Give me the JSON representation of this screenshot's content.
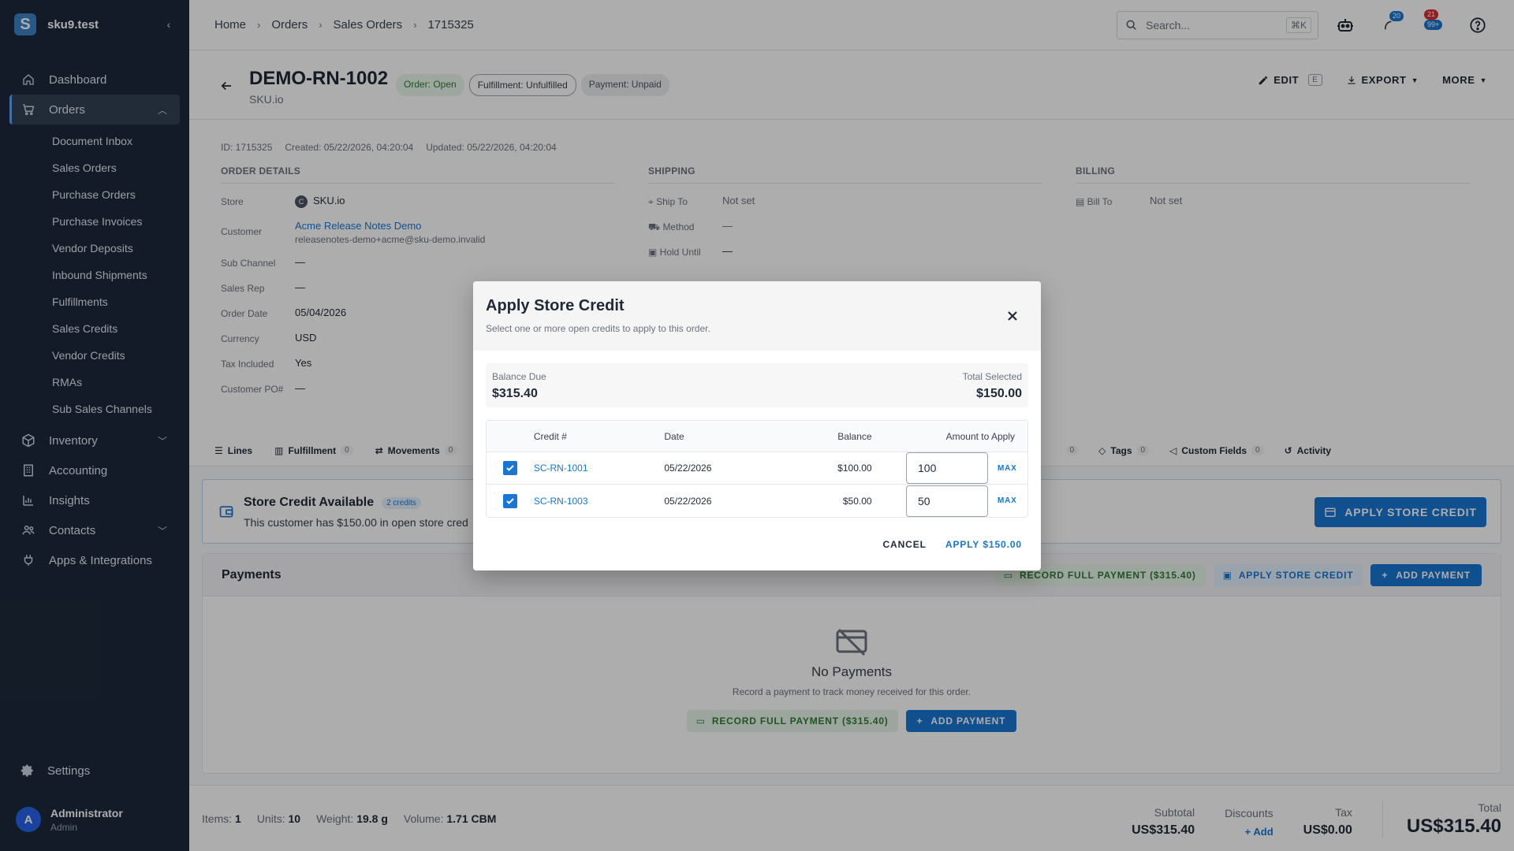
{
  "brand": {
    "logo_letter": "S",
    "name": "sku9.test"
  },
  "sidebar": {
    "items": [
      {
        "label": "Dashboard",
        "icon": "home-icon"
      },
      {
        "label": "Orders",
        "icon": "cart-icon",
        "expanded": true
      },
      {
        "label": "Inventory",
        "icon": "box-icon"
      },
      {
        "label": "Accounting",
        "icon": "building-icon"
      },
      {
        "label": "Insights",
        "icon": "chart-icon"
      },
      {
        "label": "Contacts",
        "icon": "people-icon"
      },
      {
        "label": "Apps & Integrations",
        "icon": "plug-icon"
      }
    ],
    "orders_sub": [
      "Document Inbox",
      "Sales Orders",
      "Purchase Orders",
      "Purchase Invoices",
      "Vendor Deposits",
      "Inbound Shipments",
      "Fulfillments",
      "Sales Credits",
      "Vendor Credits",
      "RMAs",
      "Sub Sales Channels"
    ],
    "settings": "Settings",
    "user": {
      "initial": "A",
      "name": "Administrator",
      "role": "Admin"
    }
  },
  "topbar": {
    "breadcrumbs": [
      "Home",
      "Orders",
      "Sales Orders",
      "1715325"
    ],
    "search_placeholder": "Search...",
    "search_kbd": "⌘K",
    "badge_notifications": "20",
    "badge_alerts_top": "21",
    "badge_alerts_bottom": "99+"
  },
  "header": {
    "title": "DEMO-RN-1002",
    "subtitle": "SKU.io",
    "chips": [
      "Order: Open",
      "Fulfillment: Unfulfilled",
      "Payment: Unpaid"
    ],
    "edit": "EDIT",
    "edit_kbd": "E",
    "export": "EXPORT",
    "more": "MORE"
  },
  "meta": {
    "id": "ID: 1715325",
    "created": "Created: 05/22/2026, 04:20:04",
    "updated": "Updated: 05/22/2026, 04:20:04"
  },
  "order_details": {
    "title": "ORDER DETAILS",
    "store_label": "Store",
    "store_initial": "C",
    "store_value": "SKU.io",
    "customer_label": "Customer",
    "customer_name": "Acme Release Notes Demo",
    "customer_email": "releasenotes-demo+acme@sku-demo.invalid",
    "sub_channel_label": "Sub Channel",
    "sub_channel": "—",
    "sales_rep_label": "Sales Rep",
    "sales_rep": "—",
    "order_date_label": "Order Date",
    "order_date": "05/04/2026",
    "currency_label": "Currency",
    "currency": "USD",
    "tax_label": "Tax Included",
    "tax": "Yes",
    "po_label": "Customer PO#",
    "po": "—"
  },
  "shipping": {
    "title": "SHIPPING",
    "ship_to_label": "Ship To",
    "ship_to": "Not set",
    "method_label": "Method",
    "method": "—",
    "hold_label": "Hold Until",
    "hold": "—"
  },
  "billing": {
    "title": "BILLING",
    "bill_to_label": "Bill To",
    "bill_to": "Not set"
  },
  "tabs": {
    "lines": "Lines",
    "fulfillment": "Fulfillment",
    "fulfillment_count": "0",
    "movements": "Movements",
    "movements_count": "0",
    "hidden_count": "0",
    "tags": "Tags",
    "tags_count": "0",
    "custom_fields": "Custom Fields",
    "custom_fields_count": "0",
    "activity": "Activity"
  },
  "store_credit": {
    "title": "Store Credit Available",
    "count": "2 credits",
    "text": "This customer has $150.00 in open store cred",
    "button": "APPLY STORE CREDIT"
  },
  "payments": {
    "title": "Payments",
    "record_full": "RECORD FULL PAYMENT ($315.40)",
    "apply_credit": "APPLY STORE CREDIT",
    "add_payment": "ADD PAYMENT",
    "empty_title": "No Payments",
    "empty_sub": "Record a payment to track money received for this order."
  },
  "footer": {
    "items_label": "Items:",
    "items": "1",
    "units_label": "Units:",
    "units": "10",
    "weight_label": "Weight:",
    "weight": "19.8 g",
    "volume_label": "Volume:",
    "volume": "1.71 CBM",
    "subtotal_label": "Subtotal",
    "subtotal": "US$315.40",
    "discounts_label": "Discounts",
    "discounts_add": "Add",
    "tax_label": "Tax",
    "tax": "US$0.00",
    "total_label": "Total",
    "total": "US$315.40"
  },
  "modal": {
    "title": "Apply Store Credit",
    "subtitle": "Select one or more open credits to apply to this order.",
    "balance_due_label": "Balance Due",
    "balance_due": "$315.40",
    "total_selected_label": "Total Selected",
    "total_selected": "$150.00",
    "columns": [
      "Credit #",
      "Date",
      "Balance",
      "Amount to Apply"
    ],
    "rows": [
      {
        "credit": "SC-RN-1001",
        "date": "05/22/2026",
        "balance": "$100.00",
        "amount": "100",
        "checked": true
      },
      {
        "credit": "SC-RN-1003",
        "date": "05/22/2026",
        "balance": "$50.00",
        "amount": "50",
        "checked": true
      }
    ],
    "max_label": "MAX",
    "cancel": "CANCEL",
    "apply": "APPLY $150.00"
  },
  "colors": {
    "sidebar_bg": "#1e293b",
    "primary": "#1976d2",
    "success": "#2e7d32"
  }
}
